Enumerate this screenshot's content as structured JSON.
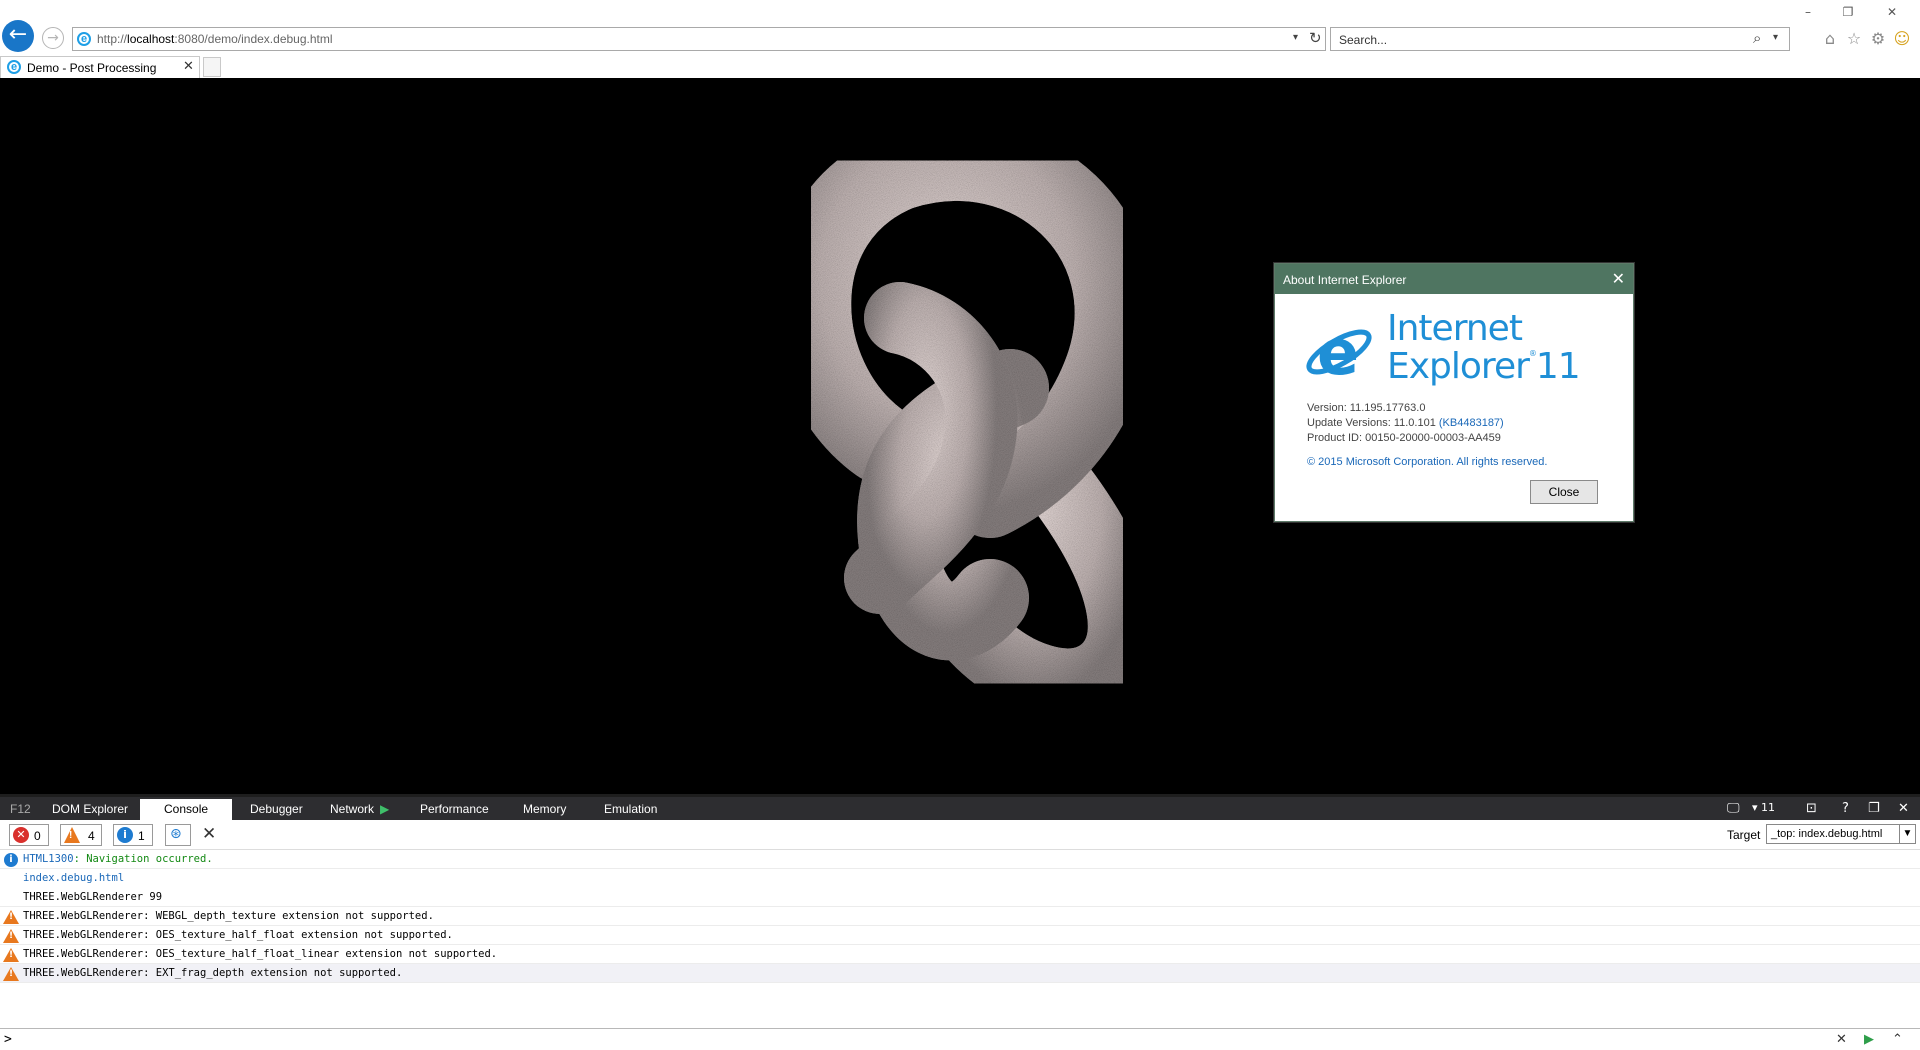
{
  "window": {
    "minimize": "–",
    "restore": "❐",
    "close": "✕"
  },
  "browser": {
    "address_host": "localhost",
    "address_prefix": "http://",
    "address_suffix": ":8080/demo/index.debug.html",
    "search_placeholder": "Search...",
    "tab_title": "Demo - Post Processing"
  },
  "dialog": {
    "title": "About Internet Explorer",
    "wordmark_line1": "Internet",
    "wordmark_line2": "Explorer",
    "wordmark_version": "11",
    "version": "Version: 11.195.17763.0",
    "update_versions_prefix": "Update Versions: 11.0.101 ",
    "update_kb": "(KB4483187)",
    "product_id": "Product ID: 00150-20000-00003-AA459",
    "copyright": "© 2015 Microsoft Corporation. All rights reserved.",
    "close_button": "Close"
  },
  "devtools": {
    "tabs": [
      "F12",
      "DOM Explorer",
      "Console",
      "Debugger",
      "Network",
      "Performance",
      "Memory",
      "Emulation"
    ],
    "doc_mode": "11",
    "filters": {
      "errors": "0",
      "warnings": "4",
      "info": "1"
    },
    "target_label": "Target",
    "target_value": "_top: index.debug.html",
    "prompt": ">",
    "logs": [
      {
        "type": "info",
        "code": "HTML1300",
        "text": ": Navigation occurred."
      },
      {
        "type": "link",
        "text": "index.debug.html"
      },
      {
        "type": "plain",
        "text": "THREE.WebGLRenderer 99"
      },
      {
        "type": "warn",
        "text": "THREE.WebGLRenderer: WEBGL_depth_texture extension not supported."
      },
      {
        "type": "warn",
        "text": "THREE.WebGLRenderer: OES_texture_half_float extension not supported."
      },
      {
        "type": "warn",
        "text": "THREE.WebGLRenderer: OES_texture_half_float_linear extension not supported."
      },
      {
        "type": "warn",
        "text": "THREE.WebGLRenderer: EXT_frag_depth extension not supported."
      }
    ]
  },
  "colors": {
    "accent": "#1976c8",
    "dialog_title_bg": "#4f7561",
    "ie_blue": "#1f8fd6",
    "devtools_bar": "#2d2d30",
    "warn": "#e8781e"
  }
}
